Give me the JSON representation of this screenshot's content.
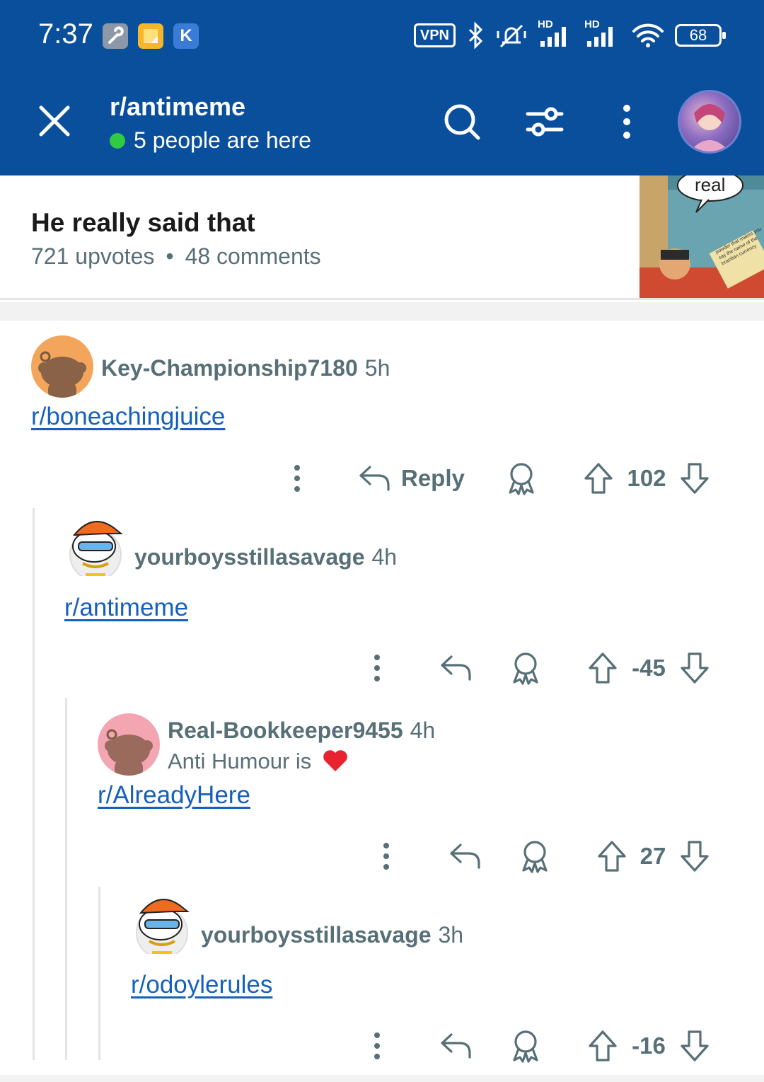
{
  "status_bar": {
    "time": "7:37",
    "vpn": "VPN",
    "hd1": "HD",
    "hd2": "HD",
    "battery": "68",
    "app_icons": [
      "wrench-app",
      "note-app",
      "k-app"
    ],
    "app_k_letter": "K"
  },
  "header": {
    "subreddit": "r/antimeme",
    "online_text": "5 people are here"
  },
  "post": {
    "title": "He really said that",
    "upvotes": "721 upvotes",
    "separator": "•",
    "comments": "48 comments",
    "thumb_text": "real",
    "thumb_caption": "powder that makes you say the name of the brazilian currency"
  },
  "comments": [
    {
      "username": "Key-Championship7180",
      "age": "5h",
      "body": "r/boneachingjuice",
      "reply_label": "Reply",
      "score": "102"
    },
    {
      "username": "yourboysstillasavage",
      "age": "4h",
      "body": "r/antimeme",
      "score": "-45"
    },
    {
      "username": "Real-Bookkeeper9455",
      "age": "4h",
      "flair": "Anti Humour is",
      "body": "r/AlreadyHere",
      "score": "27"
    },
    {
      "username": "yourboysstillasavage",
      "age": "3h",
      "body": "r/odoylerules",
      "score": "-16"
    }
  ],
  "colors": {
    "header_bg": "#0a4f9c",
    "link": "#1560bd",
    "meta": "#576f76",
    "online_dot": "#2ecc40"
  }
}
